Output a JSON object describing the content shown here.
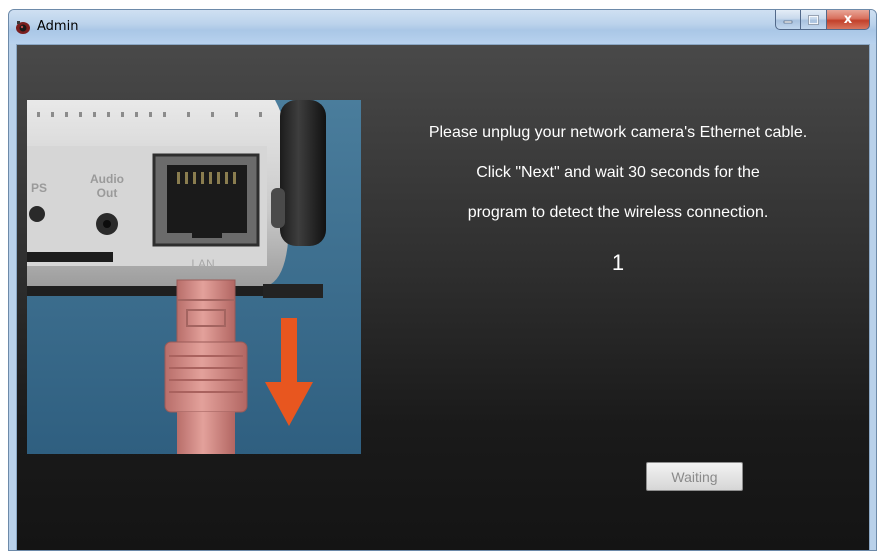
{
  "window": {
    "title": "Admin",
    "close_glyph": "x",
    "icons": {
      "app": "camera-app-icon",
      "minimize": "minimize-icon",
      "maximize": "maximize-icon",
      "close": "close-icon"
    }
  },
  "illustration": {
    "jack_label": "LAN",
    "audio_label": "Audio",
    "audio_label_2": "Out",
    "wps_label": "PS",
    "colors": {
      "background": "#3d6f8f",
      "cable": "#d98a85",
      "arrow": "#e8561f"
    }
  },
  "instructions": {
    "line1": "Please unplug your network camera's Ethernet cable.",
    "line2": "Click \"Next\" and wait 30 seconds for the",
    "line3": "program to detect the wireless connection."
  },
  "counter": {
    "value": "1"
  },
  "button": {
    "label": "Waiting"
  }
}
